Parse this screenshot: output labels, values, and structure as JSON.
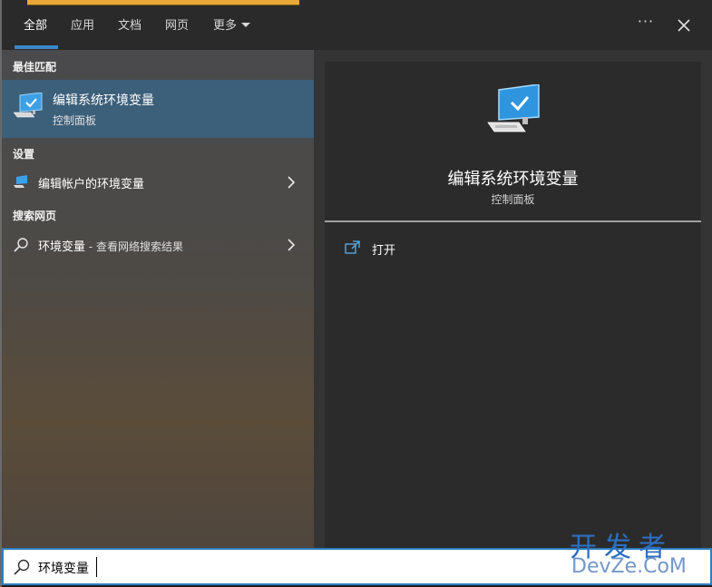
{
  "tabs": [
    {
      "label": "全部"
    },
    {
      "label": "应用"
    },
    {
      "label": "文档"
    },
    {
      "label": "网页"
    },
    {
      "label": "更多"
    }
  ],
  "more_options": "···",
  "sections": {
    "best_match": "最佳匹配",
    "settings": "设置",
    "web": "搜索网页"
  },
  "best_match_item": {
    "title": "编辑系统环境变量",
    "subtitle": "控制面板"
  },
  "settings_item": {
    "label": "编辑帐户的环境变量"
  },
  "web_item": {
    "query": "环境变量",
    "suffix": " - 查看网络搜索结果"
  },
  "preview": {
    "title": "编辑系统环境变量",
    "subtitle": "控制面板",
    "actions": [
      {
        "label": "打开"
      }
    ]
  },
  "search": {
    "value": "环境变量"
  },
  "watermark": {
    "line1": "开发者",
    "line2": "DevZe.CoM"
  },
  "colors": {
    "accent": "#3a87c9",
    "selected_row": "#3c5f7a"
  },
  "icons": [
    "computer-check-icon",
    "search-icon",
    "chevron-right-icon",
    "close-icon",
    "open-external-icon"
  ]
}
